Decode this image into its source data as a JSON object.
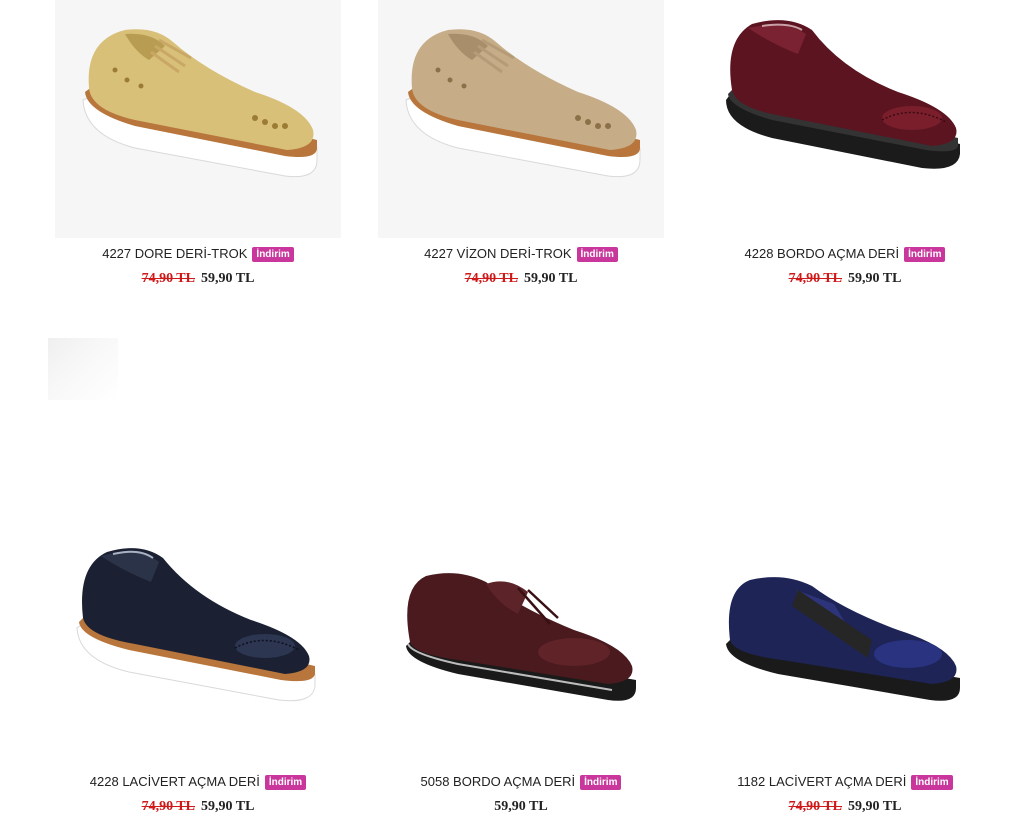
{
  "products": [
    {
      "name": "4227 DORE DERİ-TROK",
      "badge": "İndirim",
      "old_price": "74,90 TL",
      "price": "59,90 TL",
      "color": "#d4b86a"
    },
    {
      "name": "4227 VİZON DERİ-TROK",
      "badge": "İndirim",
      "old_price": "74,90 TL",
      "price": "59,90 TL",
      "color": "#c1a684"
    },
    {
      "name": "4228 BORDO AÇMA DERİ",
      "badge": "İndirim",
      "old_price": "74,90 TL",
      "price": "59,90 TL",
      "color": "#5e1520"
    },
    {
      "name": "4228 LACİVERT AÇMA DERİ",
      "badge": "İndirim",
      "old_price": "74,90 TL",
      "price": "59,90 TL",
      "color": "#1d2233"
    },
    {
      "name": "5058 BORDO AÇMA DERİ",
      "badge": "İndirim",
      "old_price": "",
      "price": "59,90 TL",
      "color": "#4b1c20"
    },
    {
      "name": "1182 LACİVERT AÇMA DERİ",
      "badge": "İndirim",
      "old_price": "74,90 TL",
      "price": "59,90 TL",
      "color": "#1c2350"
    }
  ],
  "colors": {
    "badge": "#c9369c",
    "old_price": "#d01818",
    "text": "#222222"
  }
}
